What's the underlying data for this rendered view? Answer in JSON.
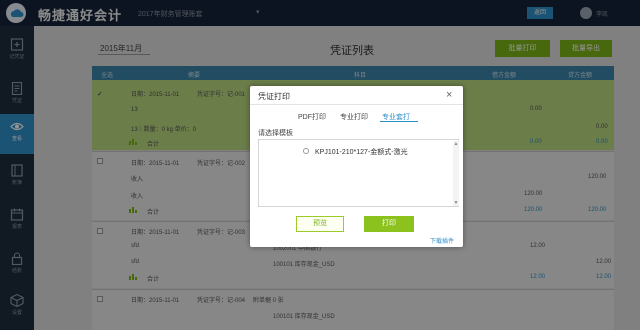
{
  "topbar": {
    "app_title": "畅捷通好会计",
    "company": "2017年财务管理账套",
    "button_label": "返回",
    "user_name": "李凯"
  },
  "sidebar": {
    "items": [
      {
        "label": "记凭证",
        "icon": "plus-square-icon",
        "active": false
      },
      {
        "label": "凭证",
        "icon": "document-icon",
        "active": false
      },
      {
        "label": "查看",
        "icon": "eye-icon",
        "active": true
      },
      {
        "label": "账簿",
        "icon": "book-icon",
        "active": false
      },
      {
        "label": "报表",
        "icon": "calendar-icon",
        "active": false
      },
      {
        "label": "结账",
        "icon": "lock-icon",
        "active": false
      },
      {
        "label": "设置",
        "icon": "box-icon",
        "active": false
      }
    ]
  },
  "toolbar": {
    "period": "2015年11月",
    "page_title": "凭证列表",
    "btn_batch_print": "批量打印",
    "btn_batch_export": "批量导出"
  },
  "table": {
    "headers": [
      "全选",
      "摘要",
      "科目",
      "借方金额",
      "贷方金额"
    ],
    "rows": [
      {
        "date": "日期：2015-11-01",
        "voucher": "凭证字号：记-001",
        "line1": "13",
        "line2": "13｜数量：0 kg  单价：0",
        "total_label": "合计",
        "debit1": "0.00",
        "credit1": "0.00",
        "debit_total": "0.00",
        "credit_total": "0.00",
        "selected": true
      },
      {
        "date": "日期：2015-11-01",
        "voucher": "凭证字号：记-002",
        "line1": "收入",
        "line2": "收入",
        "total_label": "合计",
        "debit1": "120.00",
        "credit1": "120.00",
        "debit_total": "120.00",
        "credit_total": "120.00",
        "selected": false
      },
      {
        "date": "日期：2015-11-01",
        "voucher": "凭证字号：记-003",
        "line1": "sfd",
        "line2": "sfd",
        "account1": "1002001 中国银行",
        "account2": "100101 库存现金_USD",
        "total_label": "合计",
        "debit1": "12.00",
        "credit1": "12.00",
        "debit_total": "12.00",
        "credit_total": "12.00",
        "selected": false
      },
      {
        "date": "日期：2015-11-01",
        "voucher": "凭证字号：记-004",
        "attachments": "附单据 0 张",
        "account1": "100101 库存现金_USD",
        "selected": false
      }
    ]
  },
  "modal": {
    "title": "凭证打印",
    "close": "×",
    "tabs": [
      "PDF打印",
      "专业打印",
      "专业套打"
    ],
    "active_tab": 2,
    "template_label": "请选择模板",
    "template_name": "KPJ101-210*127-金额式-激光",
    "btn_preview": "预览",
    "btn_print": "打印",
    "download_link": "下载插件"
  },
  "colors": {
    "accent": "#2d8fc9",
    "green": "#7ab317",
    "header": "#17243a",
    "sidebar": "#1e2b3c",
    "selected_row": "#b9d77f"
  }
}
